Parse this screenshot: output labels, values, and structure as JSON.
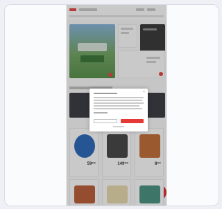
{
  "browser_window": {},
  "page": {
    "colors": {
      "brand_red": "#e53935",
      "dark_band": "#2d2f36"
    },
    "products": [
      {
        "price": "59⁹⁹"
      },
      {
        "price": "149⁹⁹"
      },
      {
        "price": "8⁹⁹"
      }
    ],
    "consent_modal": {}
  }
}
